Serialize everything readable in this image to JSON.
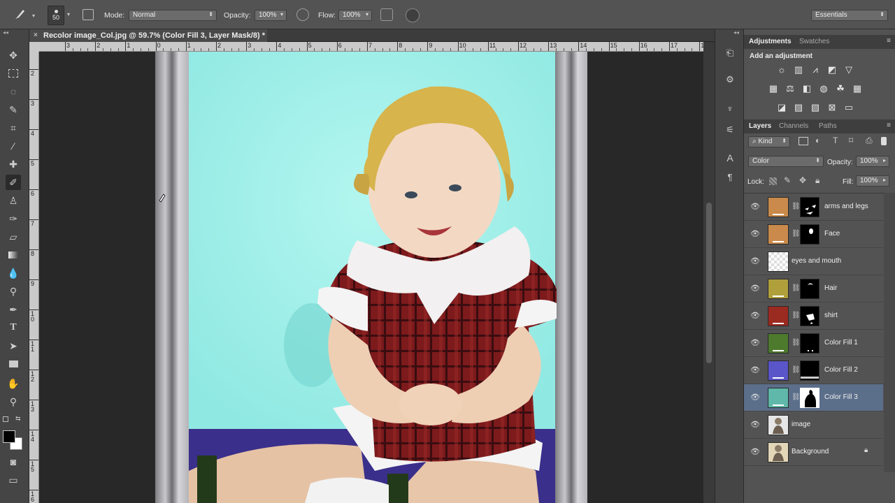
{
  "options_bar": {
    "brush_size": "50",
    "mode_label": "Mode:",
    "mode_value": "Normal",
    "opacity_label": "Opacity:",
    "opacity_value": "100%",
    "flow_label": "Flow:",
    "flow_value": "100%",
    "workspace": "Essentials"
  },
  "document": {
    "tab_title": "Recolor image_Col.jpg @ 59.7% (Color Fill 3, Layer Mask/8) *",
    "close_glyph": "×"
  },
  "rulers": {
    "horizontal": [
      "3",
      "2",
      "1",
      "0",
      "1",
      "2",
      "3",
      "4",
      "5",
      "6",
      "7",
      "8",
      "9",
      "10",
      "11",
      "12",
      "13",
      "14",
      "15",
      "16",
      "17",
      "1"
    ],
    "vertical": [
      "2",
      "3",
      "4",
      "5",
      "6",
      "7",
      "8",
      "9",
      "1 0",
      "1 1",
      "1 2",
      "1 3",
      "1 4",
      "1 5",
      "1 6"
    ]
  },
  "adjustments_panel": {
    "tabs": [
      "Adjustments",
      "Swatches"
    ],
    "heading": "Add an adjustment"
  },
  "layers_panel": {
    "tabs": [
      "Layers",
      "Channels",
      "Paths"
    ],
    "filter_kind": "Kind",
    "blend_mode": "Color",
    "opacity_label": "Opacity:",
    "opacity_value": "100%",
    "lock_label": "Lock:",
    "fill_label": "Fill:",
    "fill_value": "100%",
    "layers": [
      {
        "name": "arms and legs",
        "color": "#c98a4b",
        "type": "fill"
      },
      {
        "name": "Face",
        "color": "#c98a4b",
        "type": "fill"
      },
      {
        "name": "eyes and mouth",
        "color": "",
        "type": "empty"
      },
      {
        "name": "Hair",
        "color": "#b0a03c",
        "type": "fill"
      },
      {
        "name": "shirt",
        "color": "#9b2a20",
        "type": "fill"
      },
      {
        "name": "Color Fill 1",
        "color": "#4e7a2e",
        "type": "fill"
      },
      {
        "name": "Color Fill 2",
        "color": "#5a55c8",
        "type": "fill"
      },
      {
        "name": "Color Fill 3",
        "color": "#5fb8aa",
        "type": "fill",
        "selected": true
      },
      {
        "name": "image",
        "color": "",
        "type": "photo"
      },
      {
        "name": "Background",
        "color": "",
        "type": "photo",
        "locked": true
      }
    ]
  },
  "colors": {
    "bg_photo": "#9ef0ea",
    "shirt": "#8c1f1e",
    "floor": "#3a2f8a"
  }
}
